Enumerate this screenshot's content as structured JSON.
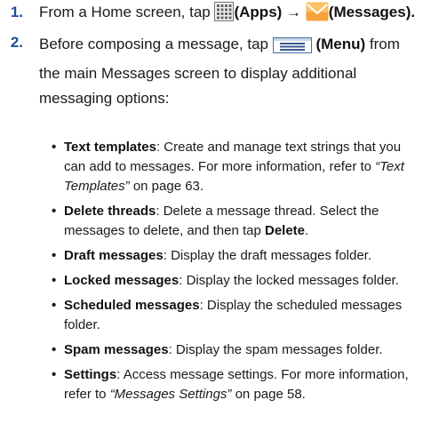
{
  "steps": [
    {
      "number": "1.",
      "pre": "From a Home screen, tap",
      "apps_icon": "apps-grid-icon",
      "apps_label": "(Apps)",
      "arrow": "→",
      "messages_icon": "messages-envelope-icon",
      "messages_label": "(Messages)",
      "end": "."
    },
    {
      "number": "2.",
      "pre": "Before composing a message, tap",
      "menu_icon": "menu-icon",
      "menu_label": "(Menu)",
      "post": "from the main Messages screen to display additional messaging options:"
    }
  ],
  "bullets": [
    {
      "bullet": "•",
      "term": "Text templates",
      "text": ": Create and manage text strings that you can add to messages. For more information, refer to ",
      "link": "“Text Templates”",
      "after": " on page 63."
    },
    {
      "bullet": "•",
      "term": "Delete threads",
      "text": ": Delete a message thread. Select the messages to delete, and then tap ",
      "bold_end": "Delete",
      "after": "."
    },
    {
      "bullet": "•",
      "term": "Draft messages",
      "text": ": Display the draft messages folder."
    },
    {
      "bullet": "•",
      "term": "Locked messages",
      "text": ": Display the locked messages folder."
    },
    {
      "bullet": "•",
      "term": "Scheduled messages",
      "text": ": Display the scheduled messages folder."
    },
    {
      "bullet": "•",
      "term": "Spam messages",
      "text": ": Display the spam messages folder."
    },
    {
      "bullet": "•",
      "term": "Settings",
      "text": ": Access message settings. For more information, refer to ",
      "link": "“Messages Settings”",
      "after": " on page 58."
    }
  ],
  "colors": {
    "step_number": "#1f4e96",
    "text": "#1a1a1a",
    "menu_icon_border": "#4a6fa5"
  }
}
